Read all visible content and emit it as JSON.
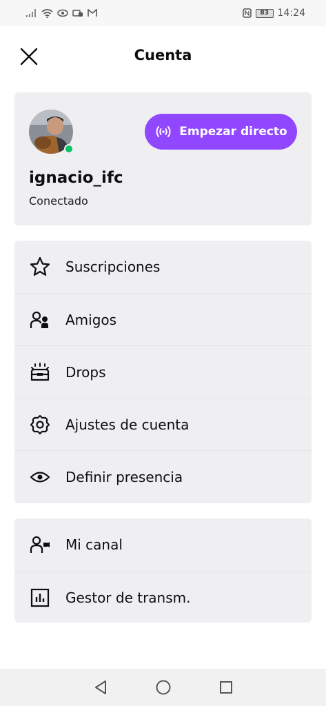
{
  "status_bar": {
    "battery": "83",
    "time": "14:24",
    "icons": [
      "signal-icon",
      "wifi-icon",
      "eye-icon",
      "notification-icon",
      "gmail-icon"
    ]
  },
  "header": {
    "title": "Cuenta",
    "close_icon": "close-icon"
  },
  "profile": {
    "username": "ignacio_ifc",
    "status": "Conectado",
    "live_button_label": "Empezar directo",
    "online_color": "#00c467"
  },
  "menu": {
    "items": [
      {
        "label": "Suscripciones",
        "icon": "star-icon"
      },
      {
        "label": "Amigos",
        "icon": "friends-icon"
      },
      {
        "label": "Drops",
        "icon": "drops-icon"
      },
      {
        "label": "Ajustes de cuenta",
        "icon": "settings-gear-icon"
      },
      {
        "label": "Definir presencia",
        "icon": "eye-icon"
      }
    ]
  },
  "menu2": {
    "items": [
      {
        "label": "Mi canal",
        "icon": "channel-icon"
      },
      {
        "label": "Gestor de transm.",
        "icon": "stream-manager-icon"
      }
    ]
  },
  "navigation_bar": {
    "buttons": [
      "back-icon",
      "home-icon",
      "recents-icon"
    ]
  },
  "colors": {
    "accent": "#9147ff",
    "card_bg": "#efeff1",
    "text": "#0e0e10"
  }
}
